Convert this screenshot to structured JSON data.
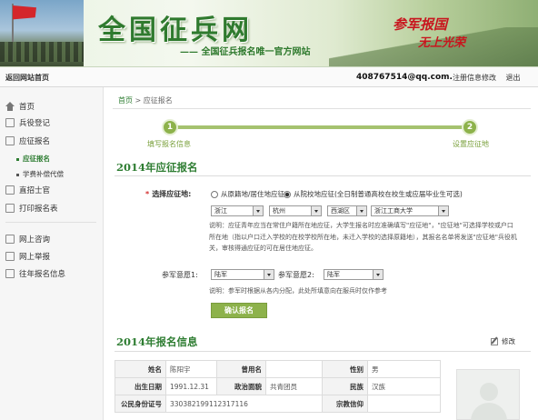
{
  "banner": {
    "title": "全国征兵网",
    "subtitle": "—— 全国征兵报名唯一官方网站",
    "slogan_line1": "参军报国",
    "slogan_line2": "无上光荣"
  },
  "topbar": {
    "home_link": "返回网站首页",
    "email": "408767514@qq.com.",
    "register_info": "注册信息修改",
    "logout": "退出"
  },
  "sidebar": {
    "home": "首页",
    "military_register": "兵役登记",
    "enlist": "应征报名",
    "enlist_sub": "应征报名",
    "tuition_sub": "学费补偿代偿",
    "direct_recruit": "直招士官",
    "print_form": "打印报名表",
    "online_consult": "网上咨询",
    "online_report": "网上举报",
    "past_info": "往年报名信息"
  },
  "breadcrumb": {
    "home": "首页",
    "sep": ">",
    "current": "应征报名"
  },
  "steps": [
    {
      "num": "1",
      "label": "填写报名信息"
    },
    {
      "num": "2",
      "label": "设置应征地"
    }
  ],
  "form": {
    "section_title": "2014年应征报名",
    "place_label": "选择应征地:",
    "radio1": "从原籍地/居住地应征",
    "radio2": "从院校地应征(全日制普通高校在校生或应届毕业生可选)",
    "selects": [
      "浙江",
      "杭州",
      "西湖区",
      "浙江工商大学"
    ],
    "note": "说明：应征青年应当在常住户籍所在地应征，大学生报名时应准确填写\"应征地\"，\"应征地\"可选择学校或户口所在地（指以户口迁入学校的在校学校所在地，未迁入学校的选择原籍地），其报名名单将发送\"应征地\"兵役机关，审核得通应征的可在居住地应征。",
    "intent1_label": "参军意愿1:",
    "intent1_value": "陆军",
    "intent2_label": "参军意愿2:",
    "intent2_value": "陆军",
    "intent_note": "说明：参军时根据从各内分配，此处所填意向在服兵时仅作参考",
    "confirm_button": "确认报名"
  },
  "info": {
    "section_title": "2014年报名信息",
    "edit_label": "修改",
    "rows": [
      [
        "姓名",
        "陈阳宇",
        "曾用名",
        "",
        "性别",
        "男"
      ],
      [
        "出生日期",
        "1991.12.31",
        "政治面貌",
        "共青团员",
        "民族",
        "汉族"
      ],
      [
        "公民身份证号",
        "330382199112317116",
        "",
        "",
        "宗教信仰",
        ""
      ]
    ]
  }
}
